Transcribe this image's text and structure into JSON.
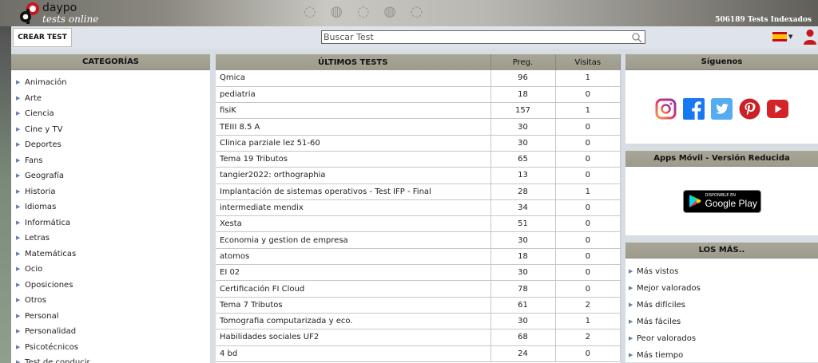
{
  "header": {
    "logo_word": "daypo",
    "logo_sub": "tests online",
    "tests_count": "506189 Tests Indexados"
  },
  "toolbar": {
    "crear_label": "CREAR TEST",
    "search_placeholder": "Buscar Test"
  },
  "categories": {
    "title": "CATEGORÍAS",
    "items": [
      "Animación",
      "Arte",
      "Ciencia",
      "Cine y TV",
      "Deportes",
      "Fans",
      "Geografía",
      "Historia",
      "Idiomas",
      "Informática",
      "Letras",
      "Matemáticas",
      "Ocio",
      "Oposiciones",
      "Otros",
      "Personal",
      "Personalidad",
      "Psicotécnicos",
      "Test de conducir"
    ]
  },
  "latest": {
    "title": "ÚLTIMOS TESTS",
    "col_preg": "Preg.",
    "col_visitas": "Visitas",
    "rows": [
      {
        "name": "Qmica",
        "preg": "96",
        "visitas": "1"
      },
      {
        "name": "pediatria",
        "preg": "18",
        "visitas": "0"
      },
      {
        "name": "fisiK",
        "preg": "157",
        "visitas": "1"
      },
      {
        "name": "TEIII 8.5 A",
        "preg": "30",
        "visitas": "0"
      },
      {
        "name": "Clinica parziale lez 51-60",
        "preg": "30",
        "visitas": "0"
      },
      {
        "name": "Tema 19 Tributos",
        "preg": "65",
        "visitas": "0"
      },
      {
        "name": "tangier2022: orthographia",
        "preg": "13",
        "visitas": "0"
      },
      {
        "name": "Implantación de sistemas operativos - Test IFP - Final",
        "preg": "28",
        "visitas": "1"
      },
      {
        "name": "intermediate mendix",
        "preg": "34",
        "visitas": "0"
      },
      {
        "name": "Xesta",
        "preg": "51",
        "visitas": "0"
      },
      {
        "name": "Economia y gestion de empresa",
        "preg": "30",
        "visitas": "0"
      },
      {
        "name": "atomos",
        "preg": "18",
        "visitas": "0"
      },
      {
        "name": "EI 02",
        "preg": "30",
        "visitas": "0"
      },
      {
        "name": "Certificación FI Cloud",
        "preg": "78",
        "visitas": "0"
      },
      {
        "name": "Tema 7 Tributos",
        "preg": "61",
        "visitas": "2"
      },
      {
        "name": "Tomografia computarizada y eco.",
        "preg": "30",
        "visitas": "1"
      },
      {
        "name": "Habilidades sociales UF2",
        "preg": "68",
        "visitas": "2"
      },
      {
        "name": "4 bd",
        "preg": "24",
        "visitas": "0"
      }
    ]
  },
  "siguenos": {
    "title": "Síguenos",
    "icons": [
      "instagram-icon",
      "facebook-icon",
      "twitter-icon",
      "pinterest-icon",
      "youtube-icon"
    ]
  },
  "apps": {
    "title": "Apps Móvil - Versión Reducida",
    "badge_small": "DISPONIBLE EN",
    "badge_big": "Google Play"
  },
  "mas": {
    "title": "LOS MÁS..",
    "items": [
      "Más vistos",
      "Mejor valorados",
      "Más difíciles",
      "Más fáciles",
      "Peor valorados",
      "Más tiempo"
    ]
  },
  "colors": {
    "panel_header": "#a8a697",
    "accent_red": "#c8161d",
    "link_arrow": "#6a7fa0"
  }
}
